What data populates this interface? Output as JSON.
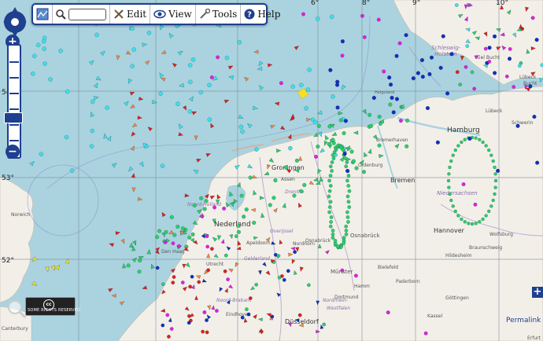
{
  "toolbar": {
    "edit_label": "Edit",
    "view_label": "View",
    "tools_label": "Tools",
    "help_label": "Help",
    "search_value": ""
  },
  "lat_labels": [
    {
      "text": "54°"
    },
    {
      "text": "53°"
    },
    {
      "text": "52°"
    }
  ],
  "lon_labels": [
    {
      "text": "6°"
    },
    {
      "text": "8°"
    },
    {
      "text": "9°"
    },
    {
      "text": "10°"
    }
  ],
  "places": [
    {
      "text": "Schleswig-"
    },
    {
      "text": "Holstein"
    },
    {
      "text": "Kiel Bucht"
    },
    {
      "text": "Lübeck"
    },
    {
      "text": "Lübeck"
    },
    {
      "text": "Bucht"
    },
    {
      "text": "Schwerin"
    },
    {
      "text": "Hamburg"
    },
    {
      "text": "Bremerhaven"
    },
    {
      "text": "Oldenburg"
    },
    {
      "text": "Bremen"
    },
    {
      "text": "Niedersachsen"
    },
    {
      "text": "Groningen"
    },
    {
      "text": "Assen"
    },
    {
      "text": "Drenthe"
    },
    {
      "text": "Noord-Holland"
    },
    {
      "text": "Nederland"
    },
    {
      "text": "Overijssel"
    },
    {
      "text": "Apeldoorn"
    },
    {
      "text": "Gelderland"
    },
    {
      "text": "Nordhorn"
    },
    {
      "text": "Osnabrück"
    },
    {
      "text": "Hannover"
    },
    {
      "text": "Wolfsburg"
    },
    {
      "text": "Braunschweig"
    },
    {
      "text": "Hildesheim"
    },
    {
      "text": "Bielefeld"
    },
    {
      "text": "Paderborn"
    },
    {
      "text": "Münster"
    },
    {
      "text": "Hamm"
    },
    {
      "text": "Dortmund"
    },
    {
      "text": "Göttingen"
    },
    {
      "text": "Kassel"
    },
    {
      "text": "Eindhoven"
    },
    {
      "text": "Nordrhein-"
    },
    {
      "text": "Westfalen"
    },
    {
      "text": "Düsseldorf"
    },
    {
      "text": "Norwich"
    },
    {
      "text": "Den Haag"
    },
    {
      "text": "Noord-Brabant"
    },
    {
      "text": "Canterbury"
    },
    {
      "text": "Erfurt"
    },
    {
      "text": "Helgoland"
    },
    {
      "text": "Utrecht"
    },
    {
      "text": "Osnabrück"
    }
  ],
  "attribution": {
    "cc_mark": "cc",
    "rights": "SOME RIGHTS RESERVED"
  },
  "permalink": "Permalink",
  "colors": {
    "sea": "#aad3df",
    "land": "#f2efe9",
    "water_blue": "#1f3f8f",
    "vessel_cyan": "#3fdfe8",
    "vessel_green": "#2ecc71",
    "vessel_red": "#e02020",
    "vessel_orange": "#ee8844",
    "vessel_blue": "#1030c0",
    "vessel_magenta": "#e020e0",
    "vessel_yellow": "#f5e020"
  },
  "map_style": {
    "show_grid": true,
    "layer": "OpenStreetMap + vessel markers"
  }
}
